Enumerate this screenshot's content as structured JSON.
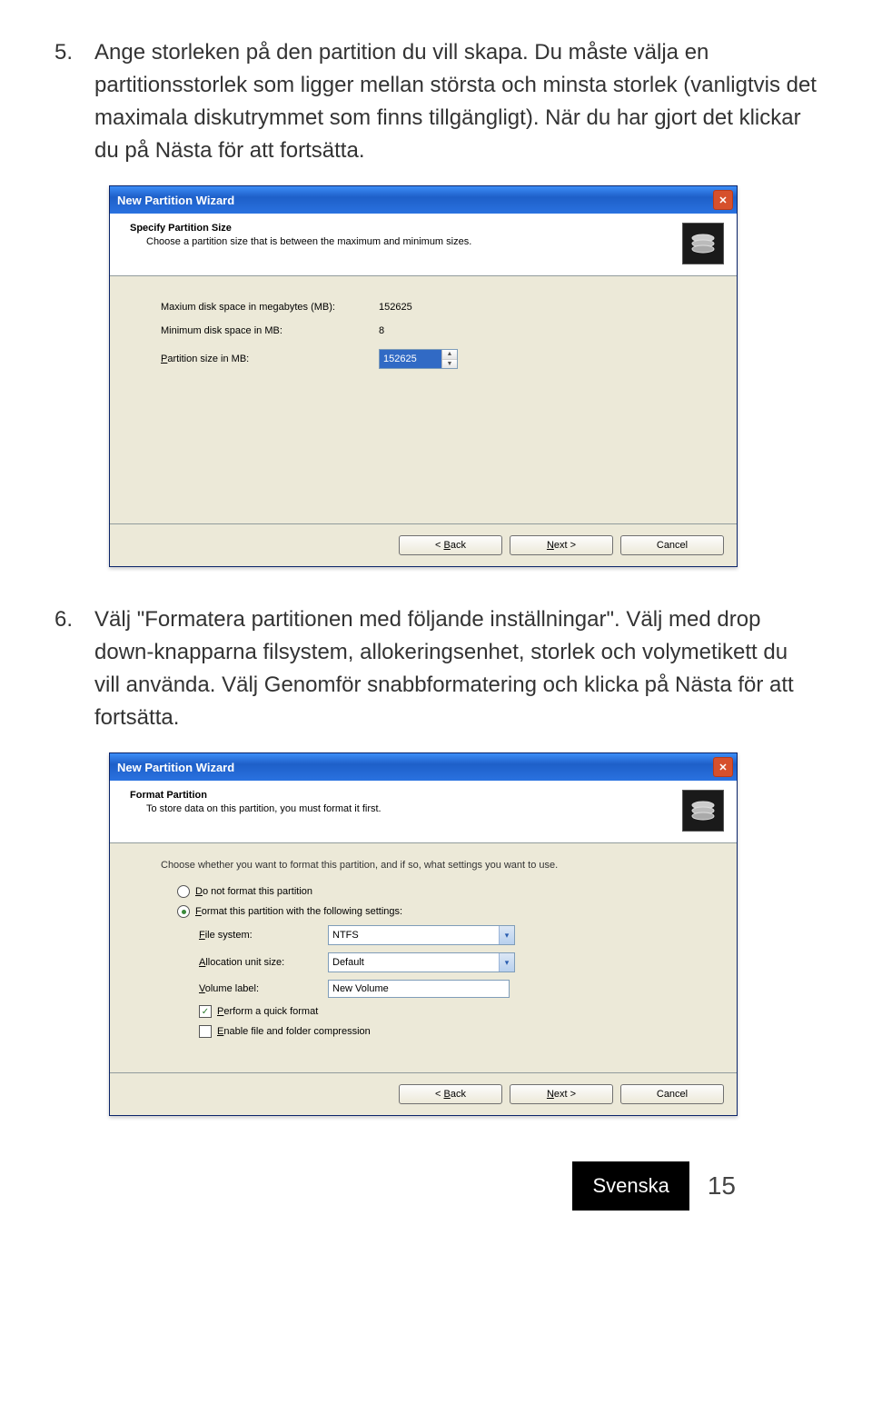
{
  "doc": {
    "step5": {
      "num": "5.",
      "text": "Ange storleken på den partition du vill skapa. Du måste välja en partitionsstorlek som ligger mellan största och minsta storlek (vanligtvis det maximala diskutrymmet som finns tillgängligt). När du har gjort det klickar du på Nästa för att fortsätta."
    },
    "step6": {
      "num": "6.",
      "text": "Välj \"Formatera partitionen med följande inställningar\". Välj med drop down-knapparna filsystem, allokeringsenhet, storlek och volymetikett du vill använda. Välj Genomför snabbformatering och klicka på Nästa för att fortsätta."
    },
    "footer_lang": "Svenska",
    "footer_page": "15"
  },
  "wizard1": {
    "title": "New Partition Wizard",
    "hdr_title": "Specify Partition Size",
    "hdr_sub": "Choose a partition size that is between the maximum and minimum sizes.",
    "max_label": "Maxium disk space in megabytes (MB):",
    "max_val": "152625",
    "min_label": "Minimum disk space in MB:",
    "min_val": "8",
    "size_label_pre": "P",
    "size_label_post": "artition size in MB:",
    "size_val": "152625",
    "back_pre": "< ",
    "back_u": "B",
    "back_post": "ack",
    "next_u": "N",
    "next_post": "ext >",
    "cancel": "Cancel"
  },
  "wizard2": {
    "title": "New Partition Wizard",
    "hdr_title": "Format Partition",
    "hdr_sub": "To store data on this partition, you must format it first.",
    "intro": "Choose whether you want to format this partition, and if so, what settings you want to use.",
    "opt1_u": "D",
    "opt1_post": "o not format this partition",
    "opt2_u": "F",
    "opt2_post": "ormat this partition with the following settings:",
    "fs_lbl_u": "F",
    "fs_lbl_post": "ile system:",
    "fs_val": "NTFS",
    "au_lbl_u": "A",
    "au_lbl_post": "llocation unit size:",
    "au_val": "Default",
    "vl_lbl_u": "V",
    "vl_lbl_post": "olume label:",
    "vl_val": "New Volume",
    "chk1_u": "P",
    "chk1_post": "erform a quick format",
    "chk2_u": "E",
    "chk2_post": "nable file and folder compression",
    "back_pre": "< ",
    "back_u": "B",
    "back_post": "ack",
    "next_u": "N",
    "next_post": "ext >",
    "cancel": "Cancel"
  }
}
